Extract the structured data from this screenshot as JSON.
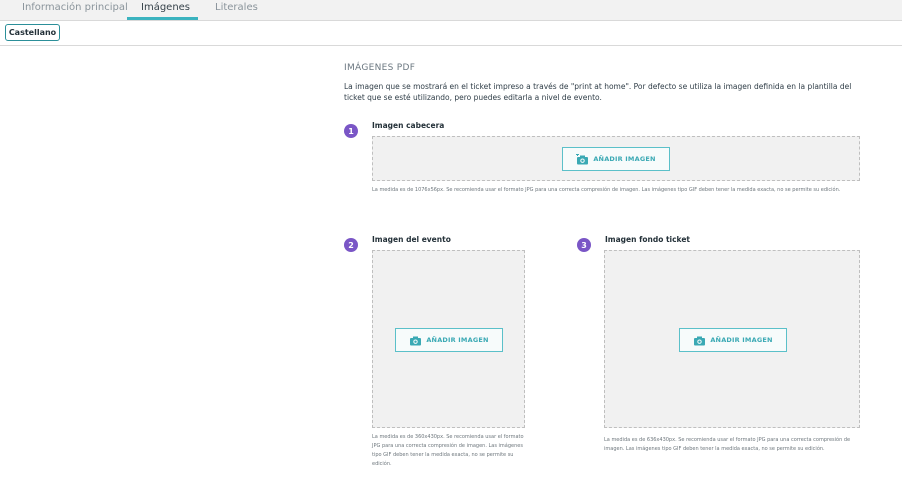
{
  "tabs": [
    {
      "label": "Información principal"
    },
    {
      "label": "Imágenes"
    },
    {
      "label": "Literales"
    }
  ],
  "language_button": "Castellano",
  "section": {
    "title": "IMÁGENES PDF",
    "description": "La imagen que se mostrará en el ticket impreso a través de \"print at home\". Por defecto se utiliza la imagen definida en la plantilla del ticket que se esté utilizando, pero puedes editarla a nivel de evento."
  },
  "images": [
    {
      "step": "1",
      "label": "Imagen cabecera",
      "button": "AÑADIR IMAGEN",
      "note": "La medida es de 1076x56px. Se recomienda usar el formato JPG para una correcta compresión de imagen. Las imágenes tipo GIF deben tener la medida exacta, no se permite su edición."
    },
    {
      "step": "2",
      "label": "Imagen del evento",
      "button": "AÑADIR IMAGEN",
      "note": "La medida es de 360x430px. Se recomienda usar el formato JPG para una correcta compresión de imagen. Las imágenes tipo GIF deben tener la medida exacta, no se permite su edición."
    },
    {
      "step": "3",
      "label": "Imagen fondo ticket",
      "button": "AÑADIR IMAGEN",
      "note": "La medida es de 636x430px. Se recomienda usar el formato JPG para una correcta compresión de imagen. Las imágenes tipo GIF deben tener la medida exacta, no se permite su edición."
    }
  ],
  "colors": {
    "accent": "#3bb3bf",
    "step_badge": "#7a56c6",
    "dropzone": "#f1f1f1"
  },
  "icons": [
    "camera-add-icon"
  ]
}
